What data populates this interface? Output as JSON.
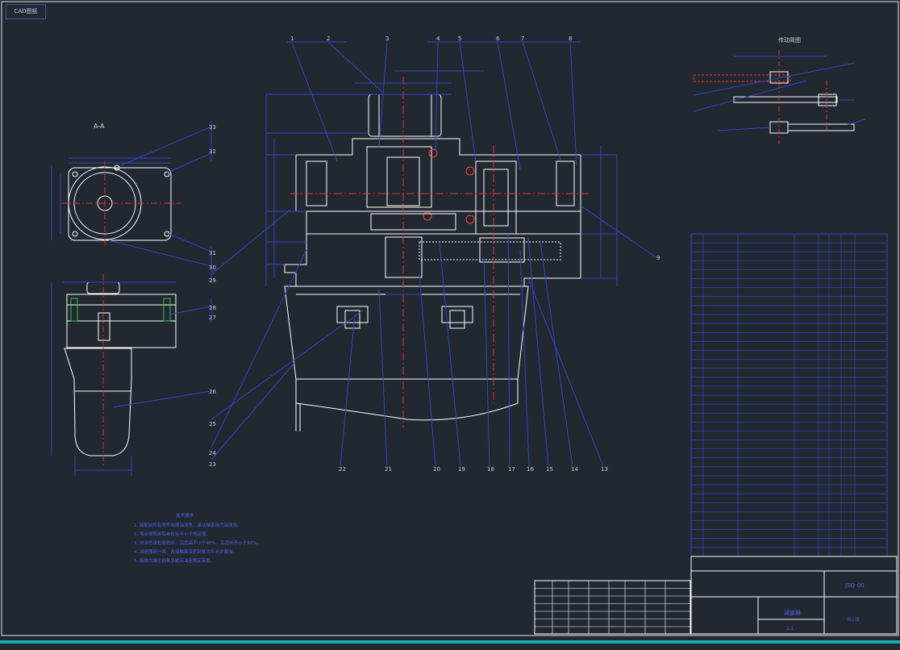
{
  "window": {
    "tag": "CAD图纸"
  },
  "views": {
    "side_label": "A-A",
    "transmission_title": "传动简图"
  },
  "callouts": {
    "top": [
      "1",
      "2",
      "3",
      "4",
      "5",
      "6",
      "7",
      "8"
    ],
    "bottom": [
      "22",
      "21",
      "20",
      "19",
      "18",
      "17",
      "16",
      "15",
      "14",
      "13"
    ],
    "right": "9",
    "left_side": [
      "33",
      "32",
      "31",
      "30",
      "29",
      "28",
      "27",
      "26",
      "25",
      "24",
      "23"
    ]
  },
  "notes": {
    "title": "技术要求",
    "lines": [
      "1. 装配前所有零件用煤油清洗，滚动轴承用汽油清洗。",
      "2. 啮合侧隙用铅丝检验不小于规定值。",
      "3. 用涂色法检验斑点，沿齿高不小于40%，沿齿长不小于50%。",
      "4. 减速器剖分面、各接触面及密封处均不允许漏油。",
      "5. 箱体内装全损耗系统用油至规定高度。"
    ]
  },
  "title_block": {
    "drawing_number": "JSQ-00",
    "name": "减速器",
    "scale": "1:1",
    "sheet": "共1张"
  },
  "colors": {
    "background": "#212830",
    "outline": "#ffffff",
    "dimension": "#3344cc",
    "center": "#e03030",
    "border": "#e8e8e8"
  }
}
